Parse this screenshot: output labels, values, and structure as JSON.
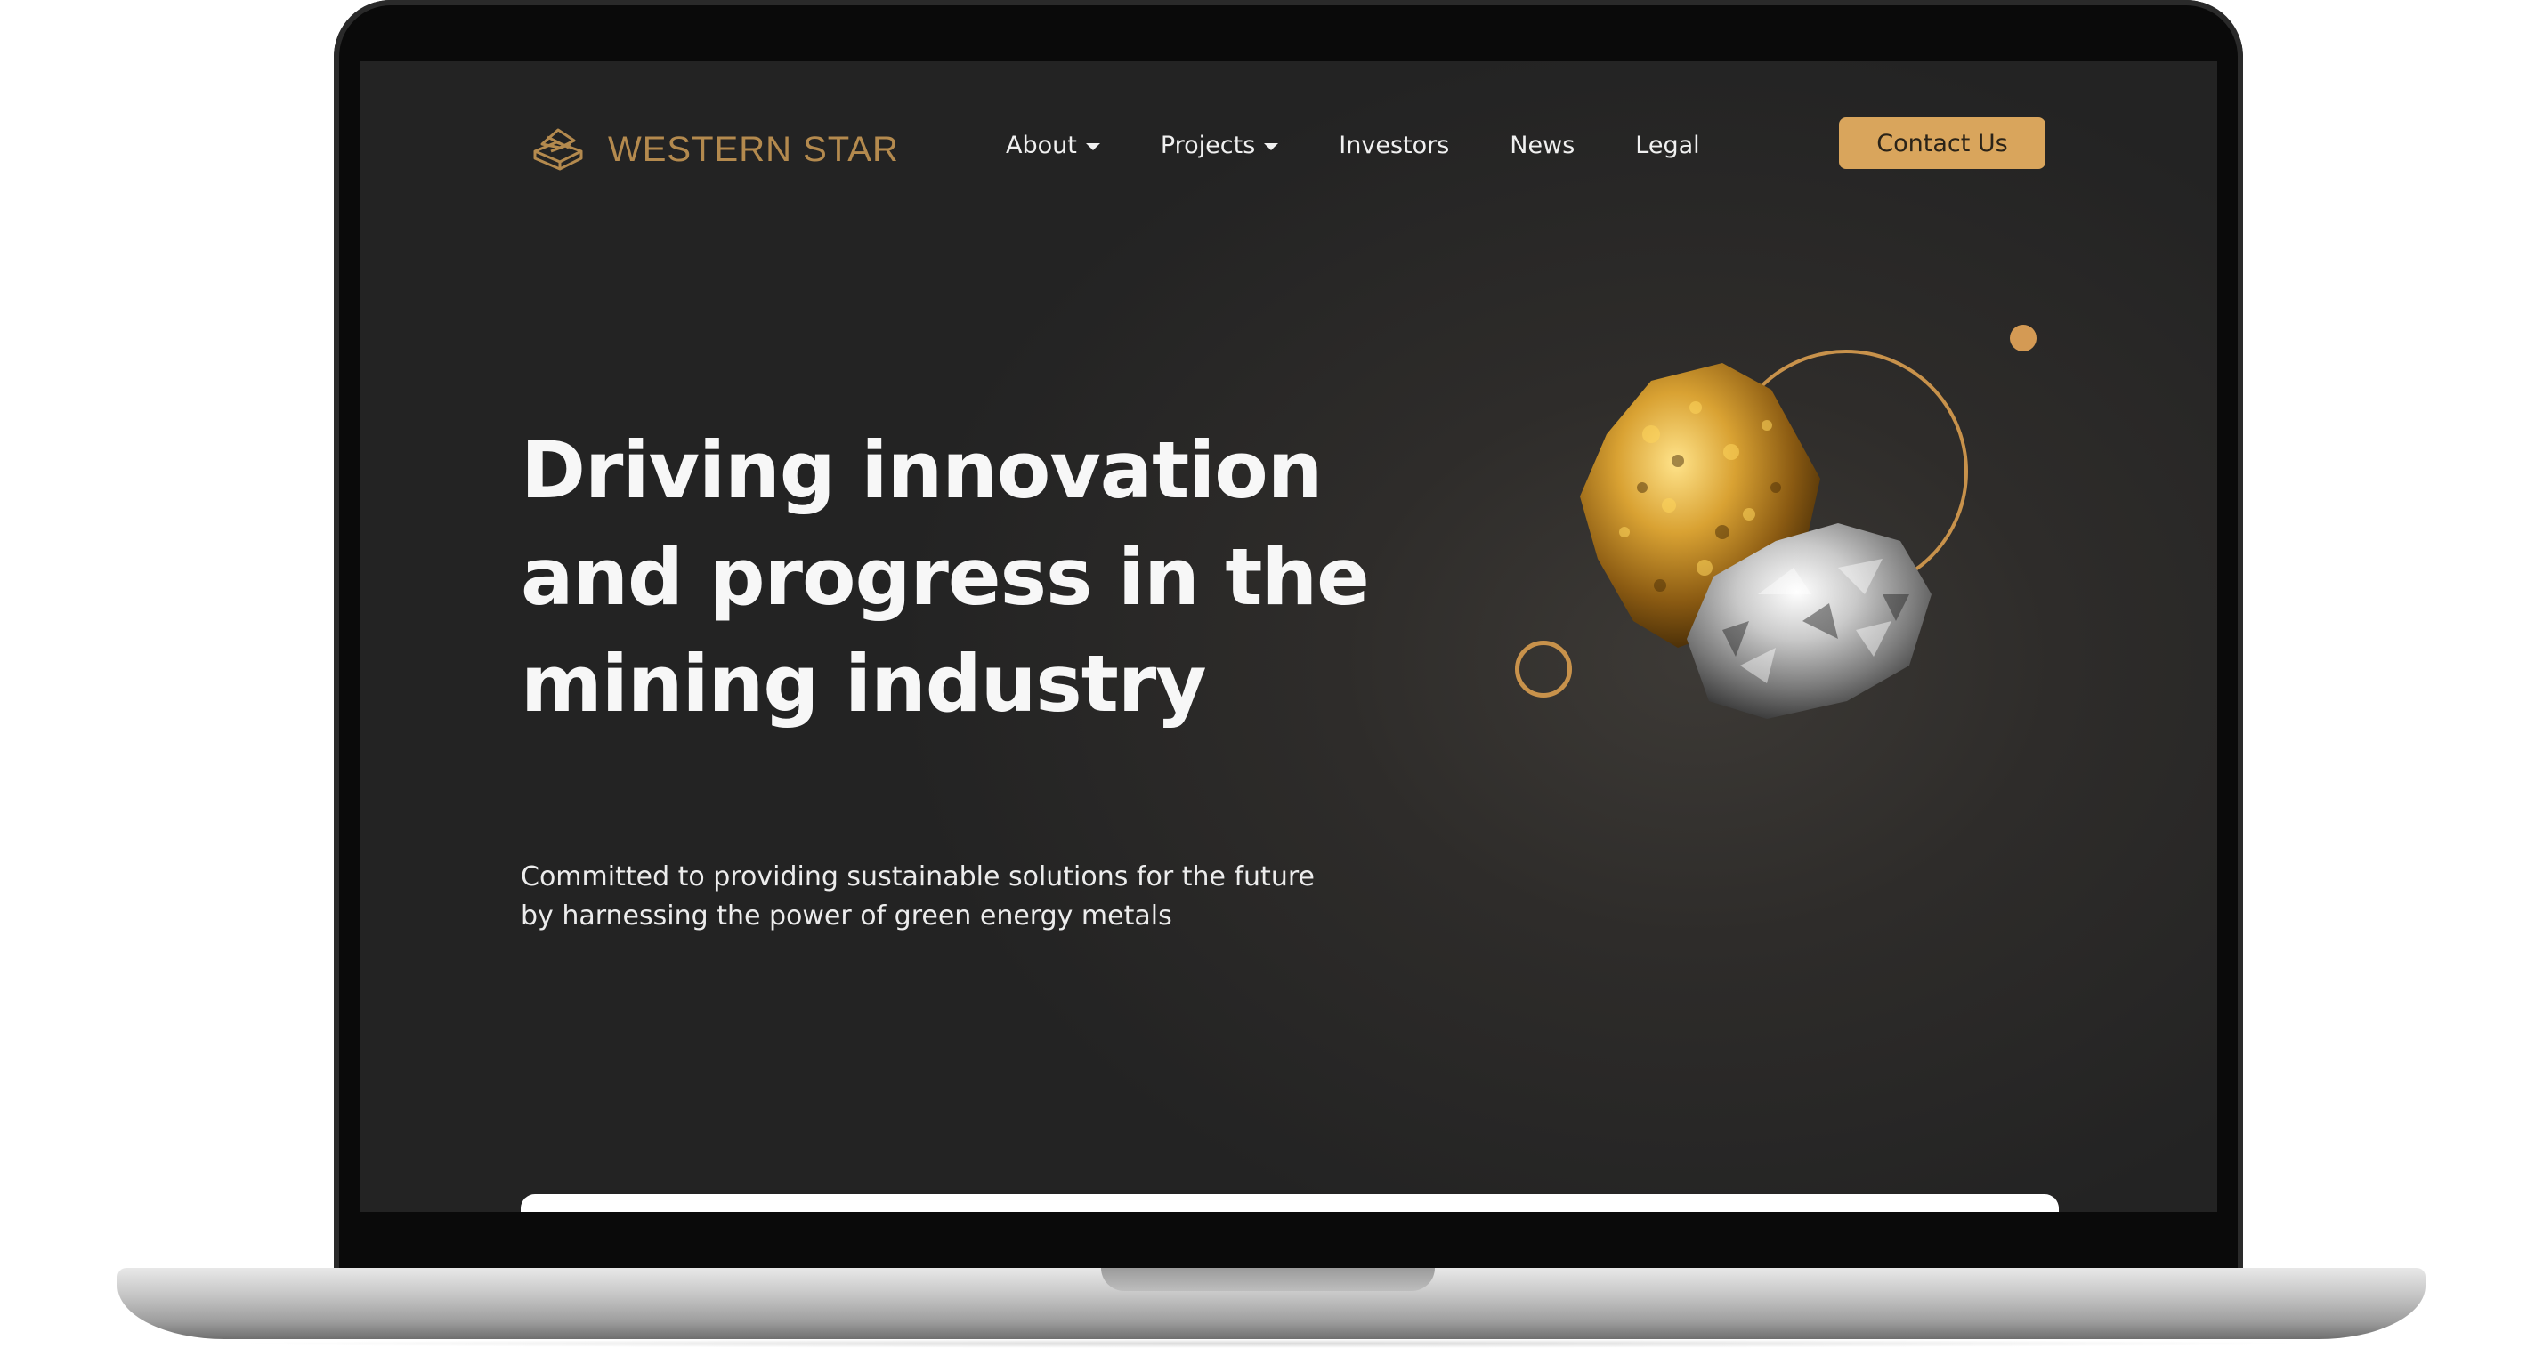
{
  "brand": {
    "name": "WESTERN STAR",
    "logo_icon": "stacked-cubes-logo-icon",
    "color": "#b48a4e"
  },
  "nav": {
    "items": [
      {
        "label": "About",
        "has_dropdown": true
      },
      {
        "label": "Projects",
        "has_dropdown": true
      },
      {
        "label": "Investors",
        "has_dropdown": false
      },
      {
        "label": "News",
        "has_dropdown": false
      },
      {
        "label": "Legal",
        "has_dropdown": false
      }
    ],
    "cta_label": "Contact Us",
    "cta_color": "#d9a55c"
  },
  "hero": {
    "title": "Driving innovation and progress in the mining industry",
    "subtitle": "Committed to providing sustainable solutions for the future by harnessing the power of green energy metals",
    "image": "gold-and-silver-ore-rocks",
    "accent_color": "#c8924b"
  },
  "colors": {
    "background": "#232323",
    "text": "#f7f7f7"
  }
}
